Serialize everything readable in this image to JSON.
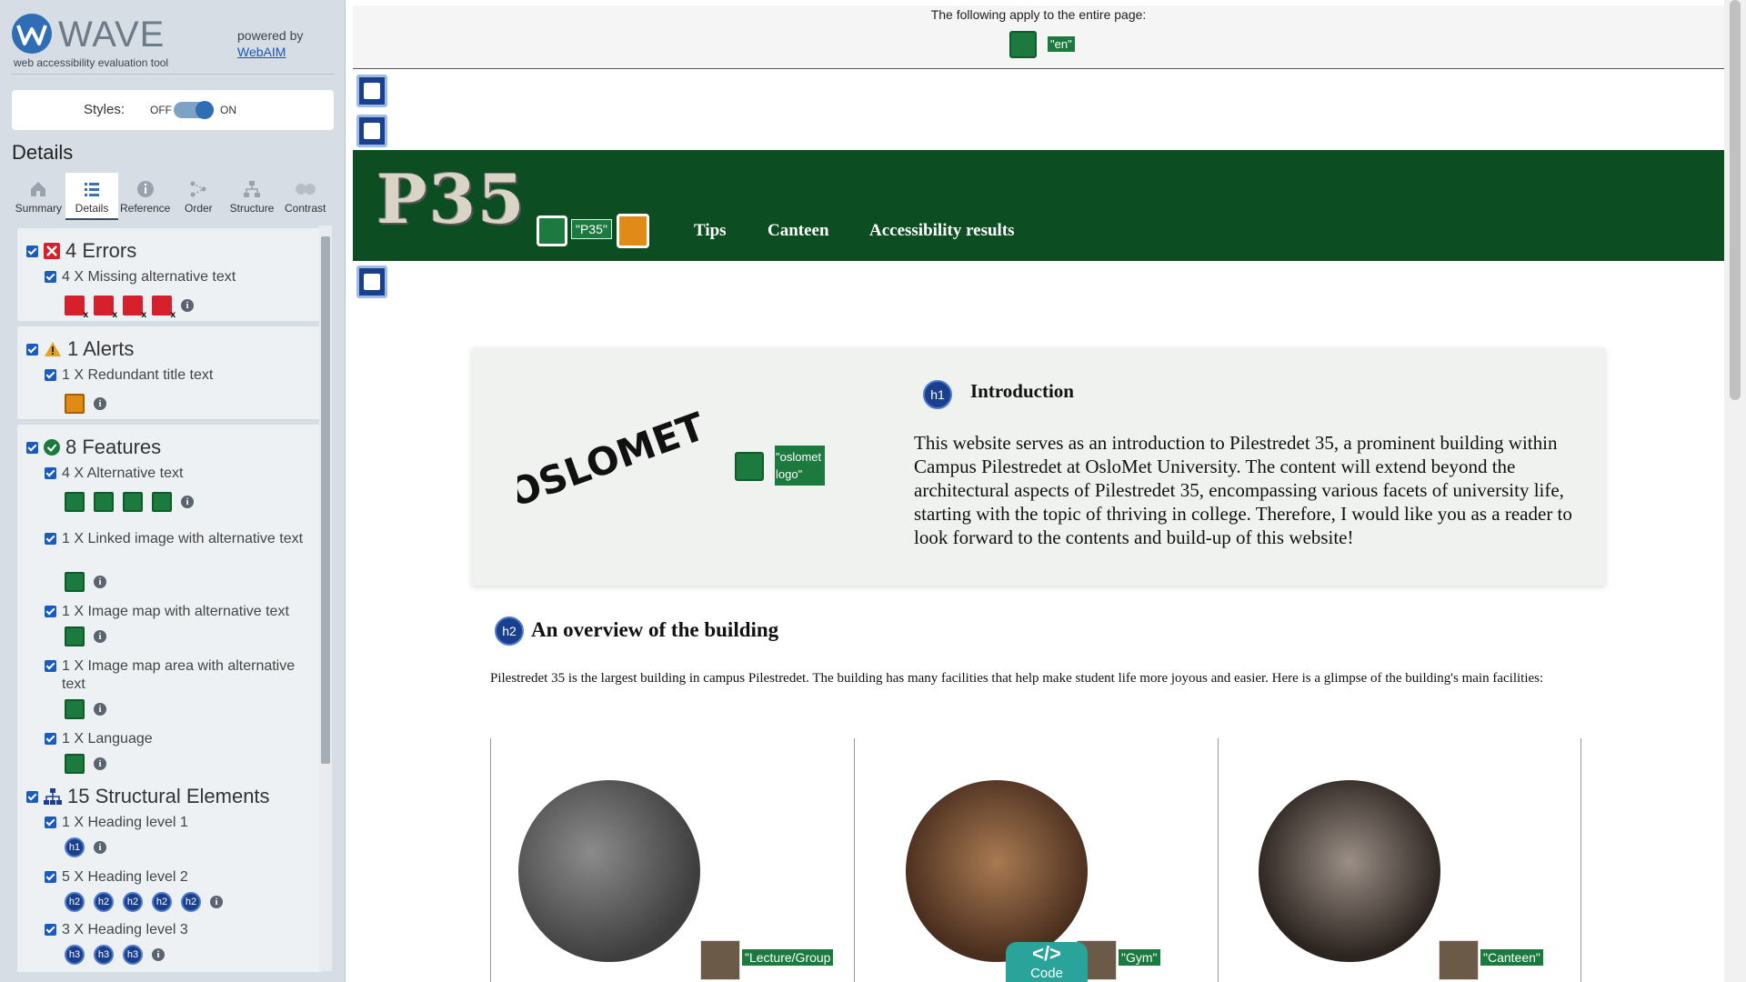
{
  "wave": {
    "brand": "WAVE",
    "tagline": "web accessibility evaluation tool",
    "powered_by": "powered by",
    "webaim_link": "WebAIM",
    "styles_label": "Styles:",
    "styles_off": "OFF",
    "styles_on": "ON",
    "details_title": "Details",
    "tabs": [
      {
        "label": "Summary",
        "icon": "home-icon"
      },
      {
        "label": "Details",
        "icon": "list-icon"
      },
      {
        "label": "Reference",
        "icon": "info-icon"
      },
      {
        "label": "Order",
        "icon": "order-icon"
      },
      {
        "label": "Structure",
        "icon": "structure-icon"
      },
      {
        "label": "Contrast",
        "icon": "contrast-icon"
      }
    ],
    "errors": {
      "header": "4 Errors",
      "items": [
        {
          "label": "4 X Missing alternative text"
        }
      ]
    },
    "alerts": {
      "header": "1 Alerts",
      "items": [
        {
          "label": "1 X Redundant title text"
        }
      ]
    },
    "features": {
      "header": "8 Features",
      "items": [
        {
          "label": "4 X Alternative text"
        },
        {
          "label": "1 X Linked image with alternative text"
        },
        {
          "label": "1 X Image map with alternative text"
        },
        {
          "label": "1 X Image map area with alternative text"
        },
        {
          "label": "1 X Language"
        }
      ]
    },
    "structure": {
      "header": "15 Structural Elements",
      "items": [
        {
          "label": "1 X Heading level 1"
        },
        {
          "label": "5 X Heading level 2"
        },
        {
          "label": "3 X Heading level 3"
        }
      ],
      "h1": "h1",
      "h2": "h2",
      "h3": "h3"
    },
    "colors": {
      "error": "#d4212b",
      "feature": "#1c7a3f",
      "alert": "#e28a17",
      "structure": "#1a3f8c"
    }
  },
  "page": {
    "global_text": "The following apply to the entire page:",
    "lang_tag": "\"en\"",
    "header": {
      "logo_text": "P35",
      "logo_alt_tag": "\"P35\"",
      "nav": [
        "Tips",
        "Canteen",
        "Accessibility results"
      ]
    },
    "intro": {
      "alt_tag": "\"oslomet logo\"",
      "logo_text": "OSLOMET",
      "badge": "h1",
      "heading": "Introduction",
      "text": "This website serves as an introduction to Pilestredet 35, a prominent building within Campus Pilestredet at OsloMet University. The content will extend beyond the architectural aspects of Pilestredet 35, encompassing various facets of university life, starting with the topic of thriving in college. Therefore, I would like you as a reader to look forward to the contents and build-up of this website!"
    },
    "overview": {
      "badge": "h2",
      "heading": "An overview of the building",
      "text": "Pilestredet 35 is the largest building in campus Pilestredet. The building has many facilities that help make student life more joyous and easier. Here is a glimpse of the building's main facilities:"
    },
    "facilities": [
      {
        "tag": "\"Lecture/Group"
      },
      {
        "tag": "\"Gym\""
      },
      {
        "tag": "\"Canteen\""
      }
    ],
    "code_button": {
      "glyph": "</>",
      "label": "Code"
    }
  }
}
